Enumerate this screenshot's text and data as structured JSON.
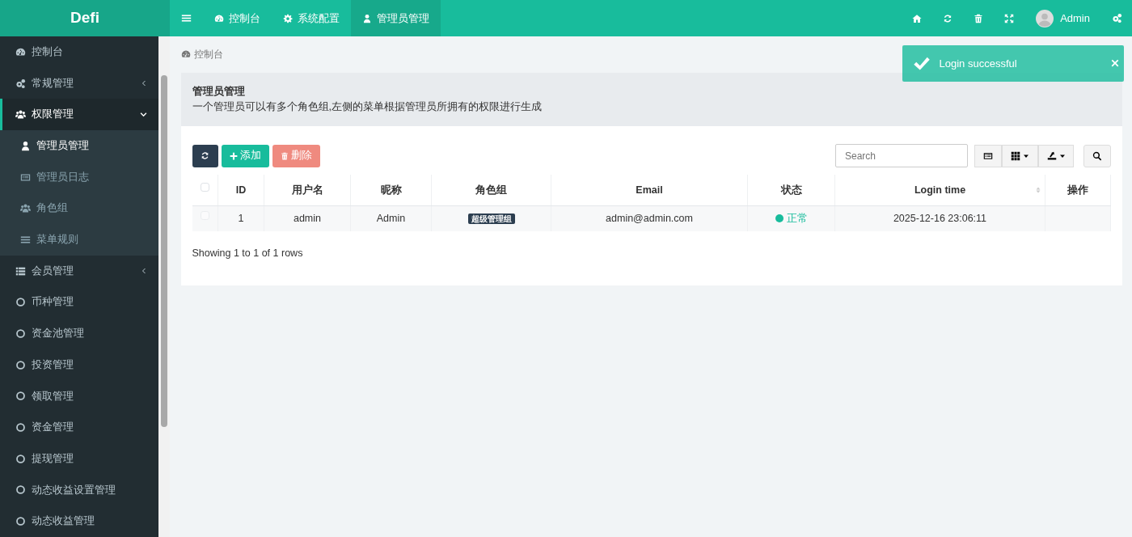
{
  "logo": "Defi",
  "topnav": [
    {
      "label": "控制台",
      "kind": "dashboard",
      "selected": false
    },
    {
      "label": "系统配置",
      "kind": "gear",
      "selected": false
    },
    {
      "label": "管理员管理",
      "kind": "user",
      "selected": true
    }
  ],
  "user": {
    "name": "Admin"
  },
  "sidebar": {
    "items": [
      {
        "label": "控制台",
        "kind": "dashboard",
        "selected": false
      },
      {
        "label": "常规管理",
        "kind": "cogs",
        "selected": false,
        "expanded": false
      },
      {
        "label": "权限管理",
        "kind": "users",
        "selected": true,
        "expanded": true,
        "children": [
          {
            "label": "管理员管理",
            "kind": "user",
            "selected": true
          },
          {
            "label": "管理员日志",
            "kind": "card",
            "selected": false
          },
          {
            "label": "角色组",
            "kind": "users",
            "selected": false
          },
          {
            "label": "菜单规则",
            "kind": "bars",
            "selected": false
          }
        ]
      },
      {
        "label": "会员管理",
        "kind": "list",
        "selected": false,
        "expanded": false
      },
      {
        "label": "币种管理",
        "kind": "circle",
        "selected": false
      },
      {
        "label": "资金池管理",
        "kind": "circle",
        "selected": false
      },
      {
        "label": "投资管理",
        "kind": "circle",
        "selected": false
      },
      {
        "label": "领取管理",
        "kind": "circle",
        "selected": false
      },
      {
        "label": "资金管理",
        "kind": "circle",
        "selected": false
      },
      {
        "label": "提现管理",
        "kind": "circle",
        "selected": false
      },
      {
        "label": "动态收益设置管理",
        "kind": "circle",
        "selected": false
      },
      {
        "label": "动态收益管理",
        "kind": "circle",
        "selected": false
      }
    ]
  },
  "breadcrumb": "控制台",
  "panel": {
    "title": "管理员管理",
    "description": "一个管理员可以有多个角色组,左侧的菜单根据管理员所拥有的权限进行生成"
  },
  "toolbar": {
    "add": {
      "label": "添加"
    },
    "delete": {
      "label": "删除",
      "disabled": true
    }
  },
  "search": {
    "placeholder": "Search"
  },
  "table": {
    "columns": [
      {
        "label": "ID",
        "sortable": false
      },
      {
        "label": "用户名",
        "sortable": false
      },
      {
        "label": "昵称",
        "sortable": false
      },
      {
        "label": "角色组",
        "sortable": false
      },
      {
        "label": "Email",
        "sortable": false
      },
      {
        "label": "状态",
        "sortable": false
      },
      {
        "label": "Login time",
        "sortable": true
      },
      {
        "label": "操作",
        "sortable": false
      }
    ],
    "header_checked": false,
    "rows": [
      {
        "checked": false,
        "id": "1",
        "username": "admin",
        "nickname": "Admin",
        "group": "超级管理组",
        "email": "admin@admin.com",
        "status": "正常",
        "color": "#18bc9c",
        "login_time": "2025-12-16 23:06:11"
      }
    ]
  },
  "pagination_info": "Showing 1 to 1 of 1 rows",
  "toast": {
    "message": "Login successful"
  }
}
